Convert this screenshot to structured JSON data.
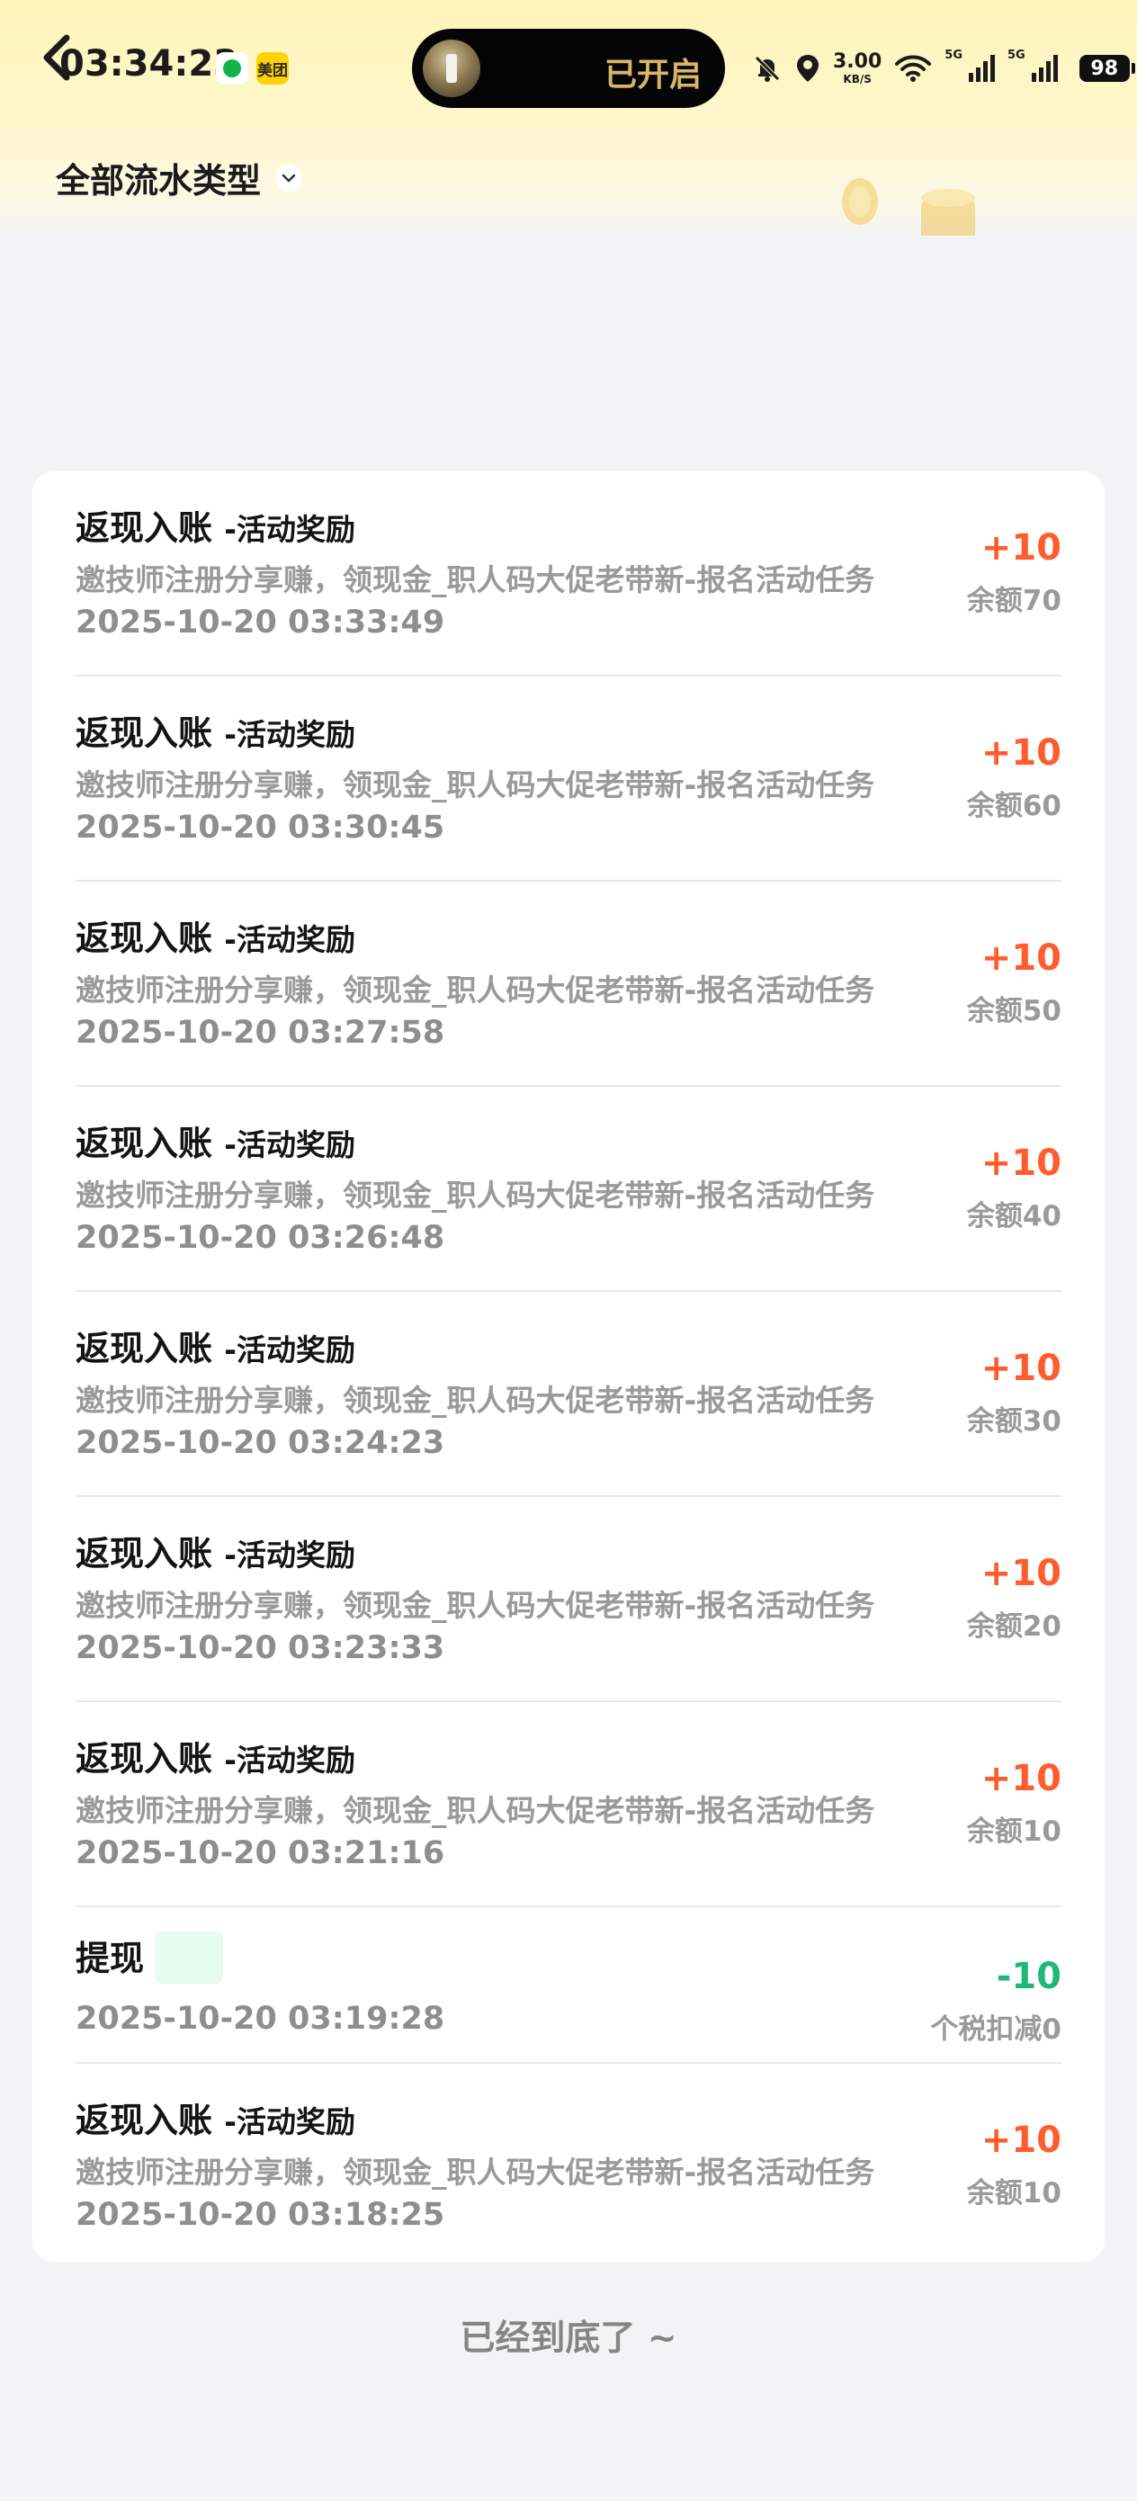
{
  "status_bar": {
    "time": "03:34:23",
    "meituan_label": "美团",
    "pill_label": "已开启",
    "net_speed_value": "3.00",
    "net_speed_unit": "KB/S",
    "signal_label_1": "5G",
    "signal_label_2": "5G",
    "battery": "98"
  },
  "filter": {
    "label": "全部流水类型"
  },
  "transactions": [
    {
      "title": "返现入账",
      "subtitle": "-活动奖励",
      "desc": "邀技师注册分享赚，领现金_职人码大促老带新-报名活动任务",
      "date": "2025-10-20 03:33:49",
      "amount": "+10",
      "balance": "余额70"
    },
    {
      "title": "返现入账",
      "subtitle": "-活动奖励",
      "desc": "邀技师注册分享赚，领现金_职人码大促老带新-报名活动任务",
      "date": "2025-10-20 03:30:45",
      "amount": "+10",
      "balance": "余额60"
    },
    {
      "title": "返现入账",
      "subtitle": "-活动奖励",
      "desc": "邀技师注册分享赚，领现金_职人码大促老带新-报名活动任务",
      "date": "2025-10-20 03:27:58",
      "amount": "+10",
      "balance": "余额50"
    },
    {
      "title": "返现入账",
      "subtitle": "-活动奖励",
      "desc": "邀技师注册分享赚，领现金_职人码大促老带新-报名活动任务",
      "date": "2025-10-20 03:26:48",
      "amount": "+10",
      "balance": "余额40"
    },
    {
      "title": "返现入账",
      "subtitle": "-活动奖励",
      "desc": "邀技师注册分享赚，领现金_职人码大促老带新-报名活动任务",
      "date": "2025-10-20 03:24:23",
      "amount": "+10",
      "balance": "余额30"
    },
    {
      "title": "返现入账",
      "subtitle": "-活动奖励",
      "desc": "邀技师注册分享赚，领现金_职人码大促老带新-报名活动任务",
      "date": "2025-10-20 03:23:33",
      "amount": "+10",
      "balance": "余额20"
    },
    {
      "title": "返现入账",
      "subtitle": "-活动奖励",
      "desc": "邀技师注册分享赚，领现金_职人码大促老带新-报名活动任务",
      "date": "2025-10-20 03:21:16",
      "amount": "+10",
      "balance": "余额10"
    },
    {
      "title": "提现",
      "date": "2025-10-20 03:19:28",
      "amount": "-10",
      "balance": "个税扣减0"
    },
    {
      "title": "返现入账",
      "subtitle": "-活动奖励",
      "desc": "邀技师注册分享赚，领现金_职人码大促老带新-报名活动任务",
      "date": "2025-10-20 03:18:25",
      "amount": "+10",
      "balance": "余额10"
    }
  ],
  "footer": {
    "end_text": "已经到底了 ~"
  },
  "colors": {
    "income": "#ff5d2e",
    "withdraw": "#1fb879",
    "header_gradient_top": "#fff4b8",
    "page_bg": "#f3f3f5"
  }
}
